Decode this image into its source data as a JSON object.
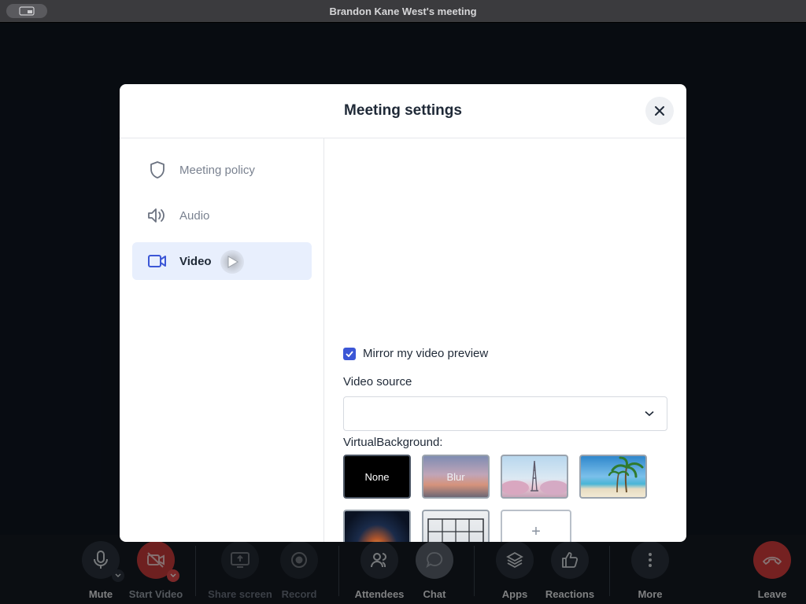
{
  "window": {
    "title": "Brandon Kane West's meeting"
  },
  "toolbar": {
    "mute": "Mute",
    "start_video": "Start Video",
    "share_screen": "Share screen",
    "record": "Record",
    "attendees": "Attendees",
    "chat": "Chat",
    "apps": "Apps",
    "reactions": "Reactions",
    "more": "More",
    "leave": "Leave"
  },
  "modal": {
    "title": "Meeting settings",
    "nav": [
      {
        "label": "Meeting policy",
        "icon": "shield-icon"
      },
      {
        "label": "Audio",
        "icon": "speaker-icon"
      },
      {
        "label": "Video",
        "icon": "video-camera-icon",
        "active": true
      }
    ],
    "video": {
      "mirror_label": "Mirror my video preview",
      "mirror_checked": true,
      "source_label": "Video source",
      "source_value": "",
      "vb_label": "VirtualBackground:",
      "tiles": [
        {
          "label": "None",
          "selected": true
        },
        {
          "label": "Blur"
        },
        {
          "label": ""
        },
        {
          "label": ""
        },
        {
          "label": ""
        },
        {
          "label": ""
        },
        {
          "label": "+"
        }
      ]
    }
  },
  "colors": {
    "accent": "#3c57d6",
    "leave": "#d63d3d",
    "active_nav_bg": "#e8effd"
  }
}
